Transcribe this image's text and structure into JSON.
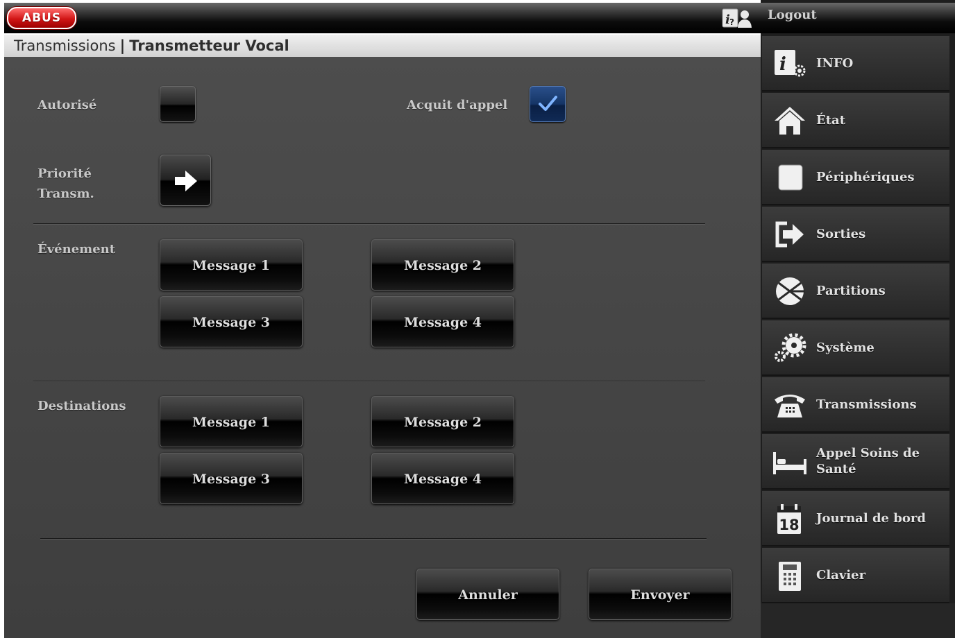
{
  "header": {
    "logo_text": "ABUS"
  },
  "breadcrumb": {
    "parent": "Transmissions",
    "separator": "|",
    "current": "Transmetteur Vocal"
  },
  "form": {
    "autorise": {
      "label": "Autorisé",
      "checked": false
    },
    "acquit_appel": {
      "label": "Acquit d'appel",
      "checked": true
    },
    "priorite": {
      "label_line1": "Priorité",
      "label_line2": "Transm.",
      "icon": "arrow-right-icon"
    },
    "evenement": {
      "label": "Événement",
      "buttons": [
        "Message 1",
        "Message 2",
        "Message 3",
        "Message 4"
      ]
    },
    "destinations": {
      "label": "Destinations",
      "buttons": [
        "Message 1",
        "Message 2",
        "Message 3",
        "Message 4"
      ]
    }
  },
  "actions": {
    "cancel": "Annuler",
    "submit": "Envoyer"
  },
  "sidebar": {
    "logout": "Logout",
    "items": [
      {
        "label": "INFO",
        "icon": "info-icon"
      },
      {
        "label": "État",
        "icon": "house-icon"
      },
      {
        "label": "Périphériques",
        "icon": "square-icon"
      },
      {
        "label": "Sorties",
        "icon": "exit-arrow-icon"
      },
      {
        "label": "Partitions",
        "icon": "partition-icon"
      },
      {
        "label": "Système",
        "icon": "gears-icon"
      },
      {
        "label": "Transmissions",
        "icon": "telephone-icon"
      },
      {
        "label": "Appel Soins de Santé",
        "icon": "bed-icon"
      },
      {
        "label": "Journal de bord",
        "icon": "calendar-icon",
        "icon_text": "18"
      },
      {
        "label": "Clavier",
        "icon": "keypad-icon"
      }
    ]
  },
  "colors": {
    "panel_bg": "#454545",
    "sidebar_bg": "#1e1e1e",
    "checkbox_checked": "#1a3a70",
    "checkmark": "#7fb4ff",
    "logo_red": "#d11515"
  }
}
